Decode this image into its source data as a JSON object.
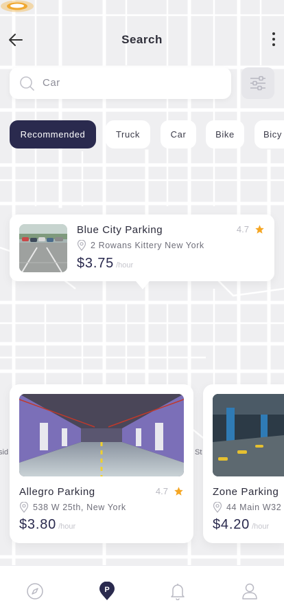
{
  "header": {
    "title": "Search"
  },
  "search": {
    "value": "Car"
  },
  "filters": [
    {
      "label": "Recommended",
      "active": true
    },
    {
      "label": "Truck",
      "active": false
    },
    {
      "label": "Car",
      "active": false
    },
    {
      "label": "Bike",
      "active": false
    },
    {
      "label": "Bicy",
      "active": false
    }
  ],
  "featured": {
    "name": "Blue City Parking",
    "rating": "4.7",
    "address": "2 Rowans Kittery New York",
    "price": "$3.75",
    "unit": "/hour"
  },
  "cards": [
    {
      "name": "Allegro Parking",
      "rating": "4.7",
      "address": "538 W 25th, New York",
      "price": "$3.80",
      "unit": "/hour"
    },
    {
      "name": "Zone Parking",
      "rating": "",
      "address": "44 Main W32",
      "price": "$4.20",
      "unit": "/hour"
    }
  ],
  "map_labels": {
    "left": "sid",
    "mid": "St"
  },
  "tabs": [
    {
      "icon": "compass-icon",
      "active": false
    },
    {
      "icon": "parking-pin-icon",
      "active": true
    },
    {
      "icon": "bell-icon",
      "active": false
    },
    {
      "icon": "user-icon",
      "active": false
    }
  ],
  "colors": {
    "accent": "#2a2a4e",
    "star": "#f5a623",
    "pin": "#f0a830"
  }
}
